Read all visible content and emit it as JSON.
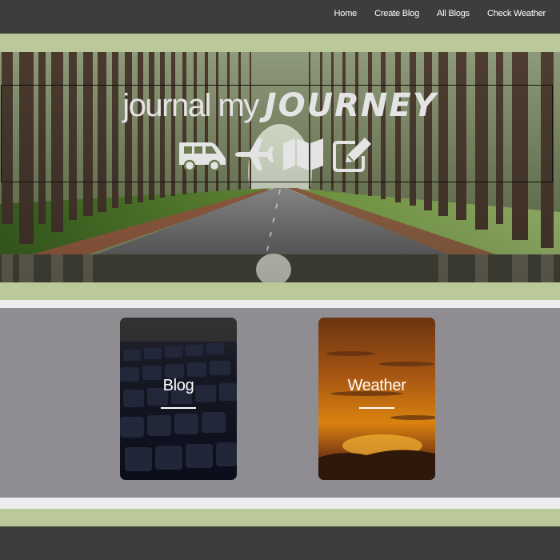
{
  "nav": {
    "links": [
      "Home",
      "Create Blog",
      "All Blogs",
      "Check Weather"
    ]
  },
  "hero": {
    "title_part1": "journal my",
    "title_part2": "JOURNEY",
    "icons": [
      "van-icon",
      "airplane-icon",
      "map-icon",
      "edit-icon"
    ]
  },
  "cards": [
    {
      "label": "Blog"
    },
    {
      "label": "Weather"
    }
  ],
  "footer": {
    "left_text": "",
    "right_text": ""
  },
  "colors": {
    "navbar": "#3d3d3d",
    "accent_green": "#bac89a",
    "separator": "#ececee",
    "main_background": "#8f8d92",
    "logo_text": "#e4e4e4"
  }
}
